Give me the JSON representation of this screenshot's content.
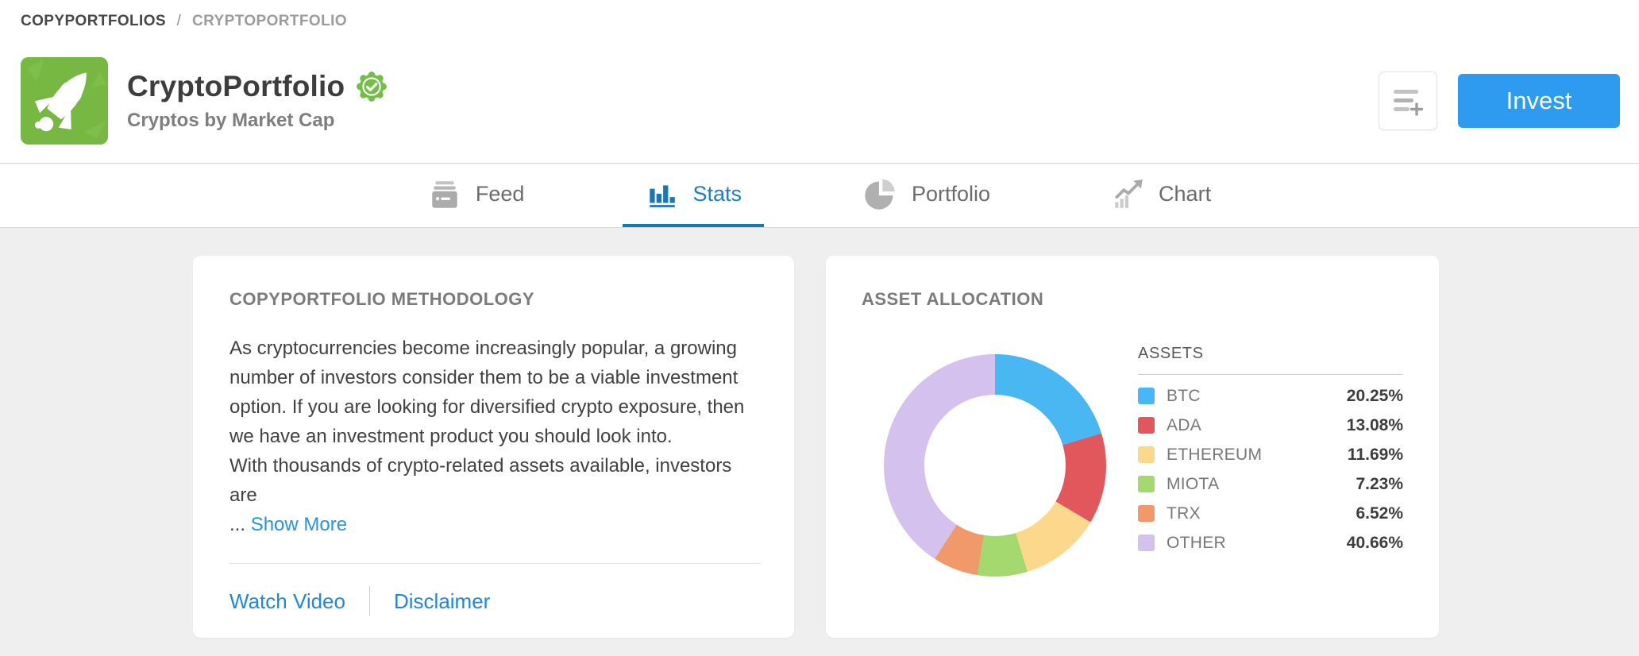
{
  "breadcrumb": {
    "parent": "COPYPORTFOLIOS",
    "separator": "/",
    "current": "CRYPTOPORTFOLIO"
  },
  "header": {
    "title": "CryptoPortfolio",
    "subtitle": "Cryptos by Market Cap",
    "invest_label": "Invest",
    "logo_icon": "rocket-icon",
    "verified_icon": "verified-badge-icon",
    "watchlist_icon": "add-to-list-icon"
  },
  "tabs": [
    {
      "label": "Feed",
      "icon": "feed-icon",
      "active": false
    },
    {
      "label": "Stats",
      "icon": "stats-icon",
      "active": true
    },
    {
      "label": "Portfolio",
      "icon": "portfolio-icon",
      "active": false
    },
    {
      "label": "Chart",
      "icon": "chart-icon",
      "active": false
    }
  ],
  "methodology_card": {
    "heading": "COPYPORTFOLIO METHODOLOGY",
    "paragraph1": "As cryptocurrencies become increasingly popular, a growing number of investors consider them to be a viable investment option. If you are looking for diversified crypto exposure, then we have an investment product you should look into.",
    "paragraph2": "With thousands of crypto-related assets available, investors are",
    "ellipsis": "...",
    "show_more_label": "Show More",
    "watch_video_label": "Watch Video",
    "disclaimer_label": "Disclaimer"
  },
  "allocation_card": {
    "heading": "ASSET ALLOCATION",
    "legend_header": "ASSETS"
  },
  "chart_data": {
    "type": "pie",
    "donut": true,
    "title": "ASSET ALLOCATION",
    "start_angle_deg": 0,
    "direction": "clockwise",
    "legend_position": "right",
    "categories": [
      "BTC",
      "ADA",
      "ETHEREUM",
      "MIOTA",
      "TRX",
      "OTHER"
    ],
    "values": [
      20.25,
      13.08,
      11.69,
      7.23,
      6.52,
      40.66
    ],
    "labels": [
      "20.25%",
      "13.08%",
      "11.69%",
      "7.23%",
      "6.52%",
      "40.66%"
    ],
    "colors": [
      "#49b7f2",
      "#e2575c",
      "#fbd88c",
      "#a3d96e",
      "#f2996c",
      "#d4c1ed"
    ]
  },
  "colors": {
    "invest_blue": "#2f9bf0",
    "active_tab_blue": "#1d80c3",
    "tab_underline_blue": "#1878b6",
    "link_blue": "#1f87db",
    "logo_green": "#77b843",
    "verified_green": "#72bf44",
    "content_background": "#efefef"
  }
}
